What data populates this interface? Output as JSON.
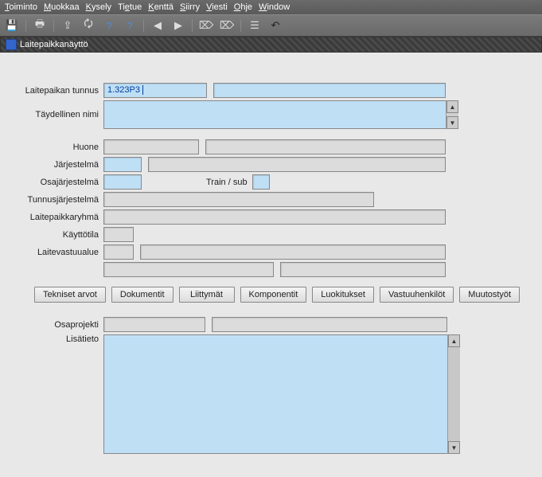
{
  "menu": {
    "toiminto": "Toiminto",
    "muokkaa": "Muokkaa",
    "kysely": "Kysely",
    "tietue": "Tietue",
    "kentta": "Kenttä",
    "siirry": "Siirry",
    "viesti": "Viesti",
    "ohje": "Ohje",
    "window": "Window"
  },
  "window_title": "Laitepaikkanäyttö",
  "labels": {
    "laitepaikan_tunnus": "Laitepaikan tunnus",
    "taydellinen_nimi": "Täydellinen nimi",
    "huone": "Huone",
    "jarjestelma": "Järjestelmä",
    "osajarjestelma": "Osajärjestelmä",
    "train_sub": "Train / sub",
    "tunnusjarjestelma": "Tunnusjärjestelmä",
    "laitepaikkaryhma": "Laitepaikkaryhmä",
    "kayttotila": "Käyttötila",
    "laitevastuualue": "Laitevastuualue",
    "osaprojekti": "Osaprojekti",
    "lisatieto": "Lisätieto"
  },
  "values": {
    "laitepaikan_tunnus": "1.323P3"
  },
  "buttons": {
    "tekniset_arvot": "Tekniset arvot",
    "dokumentit": "Dokumentit",
    "liittymat": "Liittymät",
    "komponentit": "Komponentit",
    "luokitukset": "Luokitukset",
    "vastuuhenkilot": "Vastuuhenkilöt",
    "muutostyot": "Muutostyöt"
  }
}
